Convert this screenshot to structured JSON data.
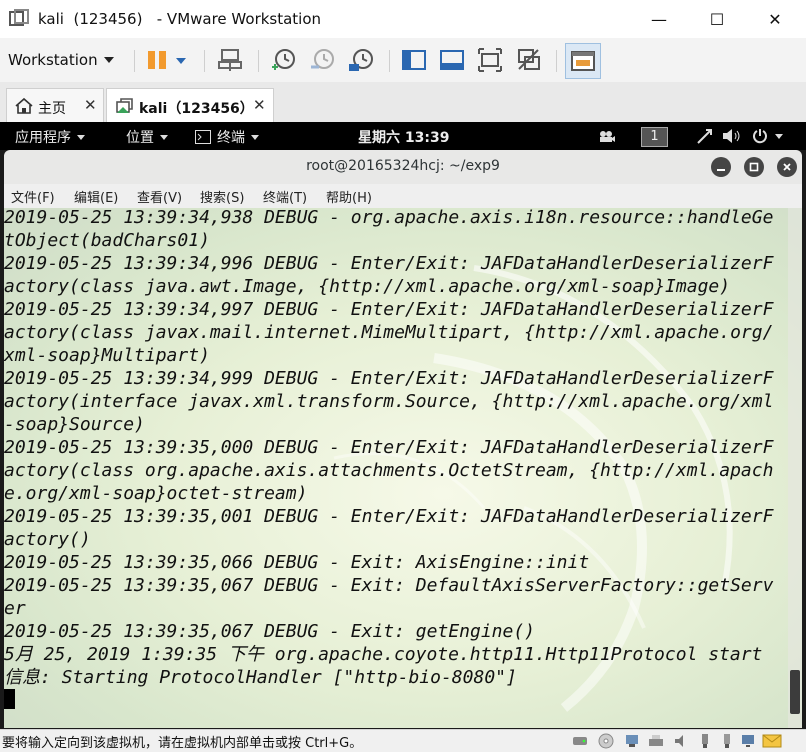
{
  "window": {
    "title": "kali  (123456)   - VMware Workstation",
    "min_glyph": "—",
    "max_glyph": "☐",
    "close_glyph": "✕"
  },
  "toolbar": {
    "workstation_label": "Workstation"
  },
  "tabs": [
    {
      "label": "主页",
      "icon": "home-icon",
      "close": "✕"
    },
    {
      "label": "kali（123456）",
      "icon": "vm-icon",
      "close": "✕"
    }
  ],
  "guest_panel": {
    "applications": "应用程序",
    "places": "位置",
    "terminal": "终端",
    "clock": "星期六 13:39",
    "workspace": "1"
  },
  "terminal": {
    "title": "root@20165324hcj: ~/exp9",
    "menu": [
      "文件(F)",
      "编辑(E)",
      "查看(V)",
      "搜索(S)",
      "终端(T)",
      "帮助(H)"
    ],
    "lines": [
      "2019-05-25 13:39:34,938 DEBUG - org.apache.axis.i18n.resource::handleGe",
      "tObject(badChars01)",
      "2019-05-25 13:39:34,996 DEBUG - Enter/Exit: JAFDataHandlerDeserializerF",
      "actory(class java.awt.Image, {http://xml.apache.org/xml-soap}Image)",
      "2019-05-25 13:39:34,997 DEBUG - Enter/Exit: JAFDataHandlerDeserializerF",
      "actory(class javax.mail.internet.MimeMultipart, {http://xml.apache.org/",
      "xml-soap}Multipart)",
      "2019-05-25 13:39:34,999 DEBUG - Enter/Exit: JAFDataHandlerDeserializerF",
      "actory(interface javax.xml.transform.Source, {http://xml.apache.org/xml",
      "-soap}Source)",
      "2019-05-25 13:39:35,000 DEBUG - Enter/Exit: JAFDataHandlerDeserializerF",
      "actory(class org.apache.axis.attachments.OctetStream, {http://xml.apach",
      "e.org/xml-soap}octet-stream)",
      "2019-05-25 13:39:35,001 DEBUG - Enter/Exit: JAFDataHandlerDeserializerF",
      "actory()",
      "2019-05-25 13:39:35,066 DEBUG - Exit: AxisEngine::init",
      "2019-05-25 13:39:35,067 DEBUG - Exit: DefaultAxisServerFactory::getServ",
      "er",
      "2019-05-25 13:39:35,067 DEBUG - Exit: getEngine()",
      "5月 25, 2019 1:39:35 下午 org.apache.coyote.http11.Http11Protocol start",
      "信息: Starting ProtocolHandler [\"http-bio-8080\"]"
    ]
  },
  "status": {
    "text": "要将输入定向到该虚拟机，请在虚拟机内部单击或按 Ctrl+G。"
  }
}
